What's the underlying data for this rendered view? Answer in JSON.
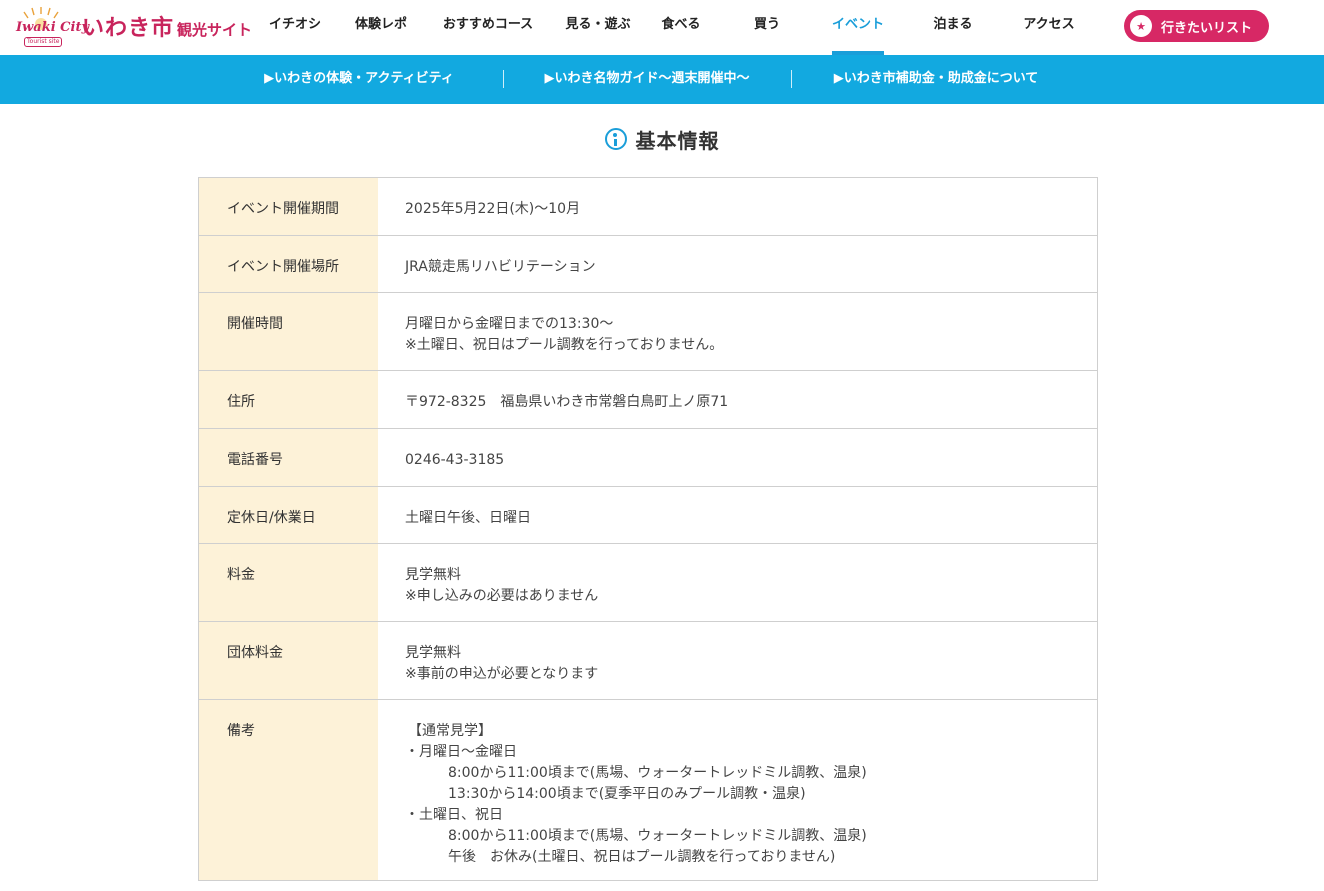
{
  "header": {
    "logo": {
      "badge_text": "Iwaki City",
      "badge_sub": "Tourist site",
      "main": "いわき市",
      "sub": "観光サイト"
    },
    "nav": [
      {
        "label": "イチオシ",
        "active": false
      },
      {
        "label": "体験レポ",
        "active": false
      },
      {
        "label": "おすすめコース",
        "active": false
      },
      {
        "label": "見る・遊ぶ",
        "active": false
      },
      {
        "label": "食べる",
        "active": false
      },
      {
        "label": "買う",
        "active": false
      },
      {
        "label": "イベント",
        "active": true
      },
      {
        "label": "泊まる",
        "active": false
      },
      {
        "label": "アクセス",
        "active": false
      }
    ],
    "wish_button": {
      "label": "行きたいリスト",
      "icon": "star-icon"
    }
  },
  "subbar": {
    "links": [
      {
        "label": "▶いわきの体験・アクティビティ"
      },
      {
        "label": "▶いわき名物ガイド〜週末開催中〜"
      },
      {
        "label": "▶いわき市補助金・助成金について"
      }
    ]
  },
  "section": {
    "title": "基本情報",
    "icon": "info-icon"
  },
  "table": {
    "rows": [
      {
        "label": "イベント開催期間",
        "lines": [
          "2025年5月22日(木)〜10月"
        ]
      },
      {
        "label": "イベント開催場所",
        "lines": [
          "JRA競走馬リハビリテーション"
        ]
      },
      {
        "label": "開催時間",
        "lines": [
          "月曜日から金曜日までの13:30〜",
          "※土曜日、祝日はプール調教を行っておりません。"
        ]
      },
      {
        "label": "住所",
        "lines": [
          "〒972-8325　福島県いわき市常磐白鳥町上ノ原71"
        ]
      },
      {
        "label": "電話番号",
        "lines": [
          "0246-43-3185"
        ]
      },
      {
        "label": "定休日/休業日",
        "lines": [
          "土曜日午後、日曜日"
        ]
      },
      {
        "label": "料金",
        "lines": [
          "見学無料",
          "※申し込みの必要はありません"
        ]
      },
      {
        "label": "団体料金",
        "lines": [
          "見学無料",
          "※事前の申込が必要となります"
        ]
      },
      {
        "label": "備考",
        "lines": [
          "【通常見学】",
          "・月曜日〜金曜日",
          "8:00から11:00頃まで(馬場、ウォータートレッドミル調教、温泉)",
          "13:30から14:00頃まで(夏季平日のみプール調教・温泉)",
          "・土曜日、祝日",
          "8:00から11:00頃まで(馬場、ウォータートレッドミル調教、温泉)",
          "午後　お休み(土曜日、祝日はプール調教を行っておりません)"
        ]
      }
    ]
  },
  "colors": {
    "accent": "#12a9e0",
    "brand": "#c8245c",
    "button": "#d72865",
    "label_bg": "#fdf2d8"
  }
}
